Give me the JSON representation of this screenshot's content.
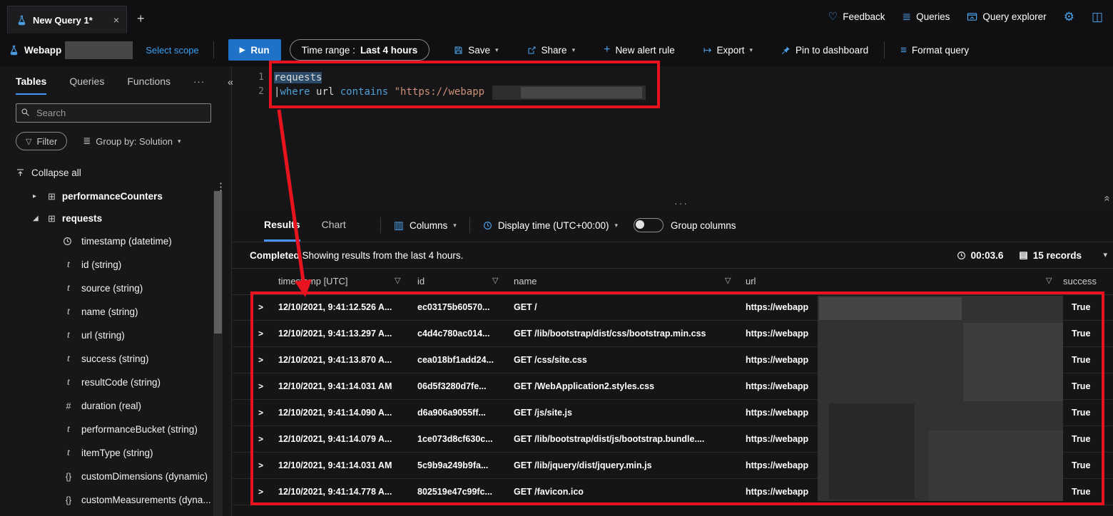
{
  "colors": {
    "accent_blue": "#4894fe",
    "command_icon_blue": "#4ba0e8",
    "run_button_blue": "#1f72c8",
    "annotation_red": "#e8131f",
    "keyword_blue": "#4f9fd6",
    "string_orange": "#ce9178"
  },
  "glyphs": {
    "close": "×",
    "plus": "+",
    "heart": "♡",
    "gear": "⚙",
    "panel": "◫",
    "list": "≣",
    "chevron_down": "▾",
    "chevron_right": "▸",
    "chevron_expanded": "◢",
    "run": "▶",
    "export_arrow": "↦",
    "format": "≡",
    "overflow": "···",
    "collapse_left": "«",
    "more_v": "⋮",
    "funnel": "▽",
    "table": "⊞",
    "records": "▤",
    "columns": "▥",
    "row_chevron": ">",
    "dots_handle": "···",
    "double_chevron_up": "«"
  },
  "topbar": {
    "tab_title": "New Query 1*",
    "feedback": "Feedback",
    "queries": "Queries",
    "query_explorer": "Query explorer"
  },
  "toolbar": {
    "scope_name": "Webapp",
    "select_scope": "Select scope",
    "run_label": "Run",
    "time_range_label": "Time range :",
    "time_range_value": "Last 4 hours",
    "save_label": "Save",
    "share_label": "Share",
    "new_alert_rule_label": "New alert rule",
    "export_label": "Export",
    "pin_label": "Pin to dashboard",
    "format_label": "Format query"
  },
  "sidebar": {
    "tabs": [
      {
        "label": "Tables"
      },
      {
        "label": "Queries"
      },
      {
        "label": "Functions"
      }
    ],
    "search_placeholder": "Search",
    "filter_label": "Filter",
    "group_by_label": "Group by: Solution",
    "collapse_all_label": "Collapse all",
    "tables": [
      {
        "label": "performanceCounters"
      },
      {
        "label": "requests"
      }
    ],
    "fields": [
      {
        "label": "timestamp (datetime)",
        "glyph": ""
      },
      {
        "label": "id (string)",
        "glyph": "t"
      },
      {
        "label": "source (string)",
        "glyph": "t"
      },
      {
        "label": "name (string)",
        "glyph": "t"
      },
      {
        "label": "url (string)",
        "glyph": "t"
      },
      {
        "label": "success (string)",
        "glyph": "t"
      },
      {
        "label": "resultCode (string)",
        "glyph": "t"
      },
      {
        "label": "duration (real)",
        "glyph": "#"
      },
      {
        "label": "performanceBucket (string)",
        "glyph": "t"
      },
      {
        "label": "itemType (string)",
        "glyph": "t"
      },
      {
        "label": "customDimensions (dynamic)",
        "glyph": "{}"
      },
      {
        "label": "customMeasurements (dyna...",
        "glyph": "{}"
      }
    ]
  },
  "editor": {
    "line1_number": "1",
    "line2_number": "2",
    "line1_text": "requests",
    "pipe": "|",
    "kw_where": "where",
    "col_url": " url ",
    "kw_contains": "contains",
    "str_value": " \"https://webapp"
  },
  "results": {
    "tab_results": "Results",
    "tab_chart": "Chart",
    "columns_label": "Columns",
    "display_time_label": "Display time (UTC+00:00)",
    "group_columns_label": "Group columns",
    "status_completed": "Completed.",
    "status_message": " Showing results from the last 4 hours.",
    "elapsed": "00:03.6",
    "record_count": "15 records",
    "table": {
      "headers": [
        {
          "label": "timestamp [UTC]"
        },
        {
          "label": "id"
        },
        {
          "label": "name"
        },
        {
          "label": "url"
        },
        {
          "label": "success"
        }
      ],
      "rows": [
        {
          "timestamp": "12/10/2021, 9:41:12.526 A...",
          "id": "ec03175b60570...",
          "name": "GET /",
          "url": "https://webapp",
          "success": "True"
        },
        {
          "timestamp": "12/10/2021, 9:41:13.297 A...",
          "id": "c4d4c780ac014...",
          "name": "GET /lib/bootstrap/dist/css/bootstrap.min.css",
          "url": "https://webapp",
          "success": "True"
        },
        {
          "timestamp": "12/10/2021, 9:41:13.870 A...",
          "id": "cea018bf1add24...",
          "name": "GET /css/site.css",
          "url": "https://webapp",
          "success": "True"
        },
        {
          "timestamp": "12/10/2021, 9:41:14.031 AM",
          "id": "06d5f3280d7fe...",
          "name": "GET /WebApplication2.styles.css",
          "url": "https://webapp",
          "success": "True"
        },
        {
          "timestamp": "12/10/2021, 9:41:14.090 A...",
          "id": "d6a906a9055ff...",
          "name": "GET /js/site.js",
          "url": "https://webapp",
          "success": "True"
        },
        {
          "timestamp": "12/10/2021, 9:41:14.079 A...",
          "id": "1ce073d8cf630c...",
          "name": "GET /lib/bootstrap/dist/js/bootstrap.bundle....",
          "url": "https://webapp",
          "success": "True"
        },
        {
          "timestamp": "12/10/2021, 9:41:14.031 AM",
          "id": "5c9b9a249b9fa...",
          "name": "GET /lib/jquery/dist/jquery.min.js",
          "url": "https://webapp",
          "success": "True"
        },
        {
          "timestamp": "12/10/2021, 9:41:14.778 A...",
          "id": "802519e47c99fc...",
          "name": "GET /favicon.ico",
          "url": "https://webapp",
          "success": "True"
        }
      ]
    }
  }
}
